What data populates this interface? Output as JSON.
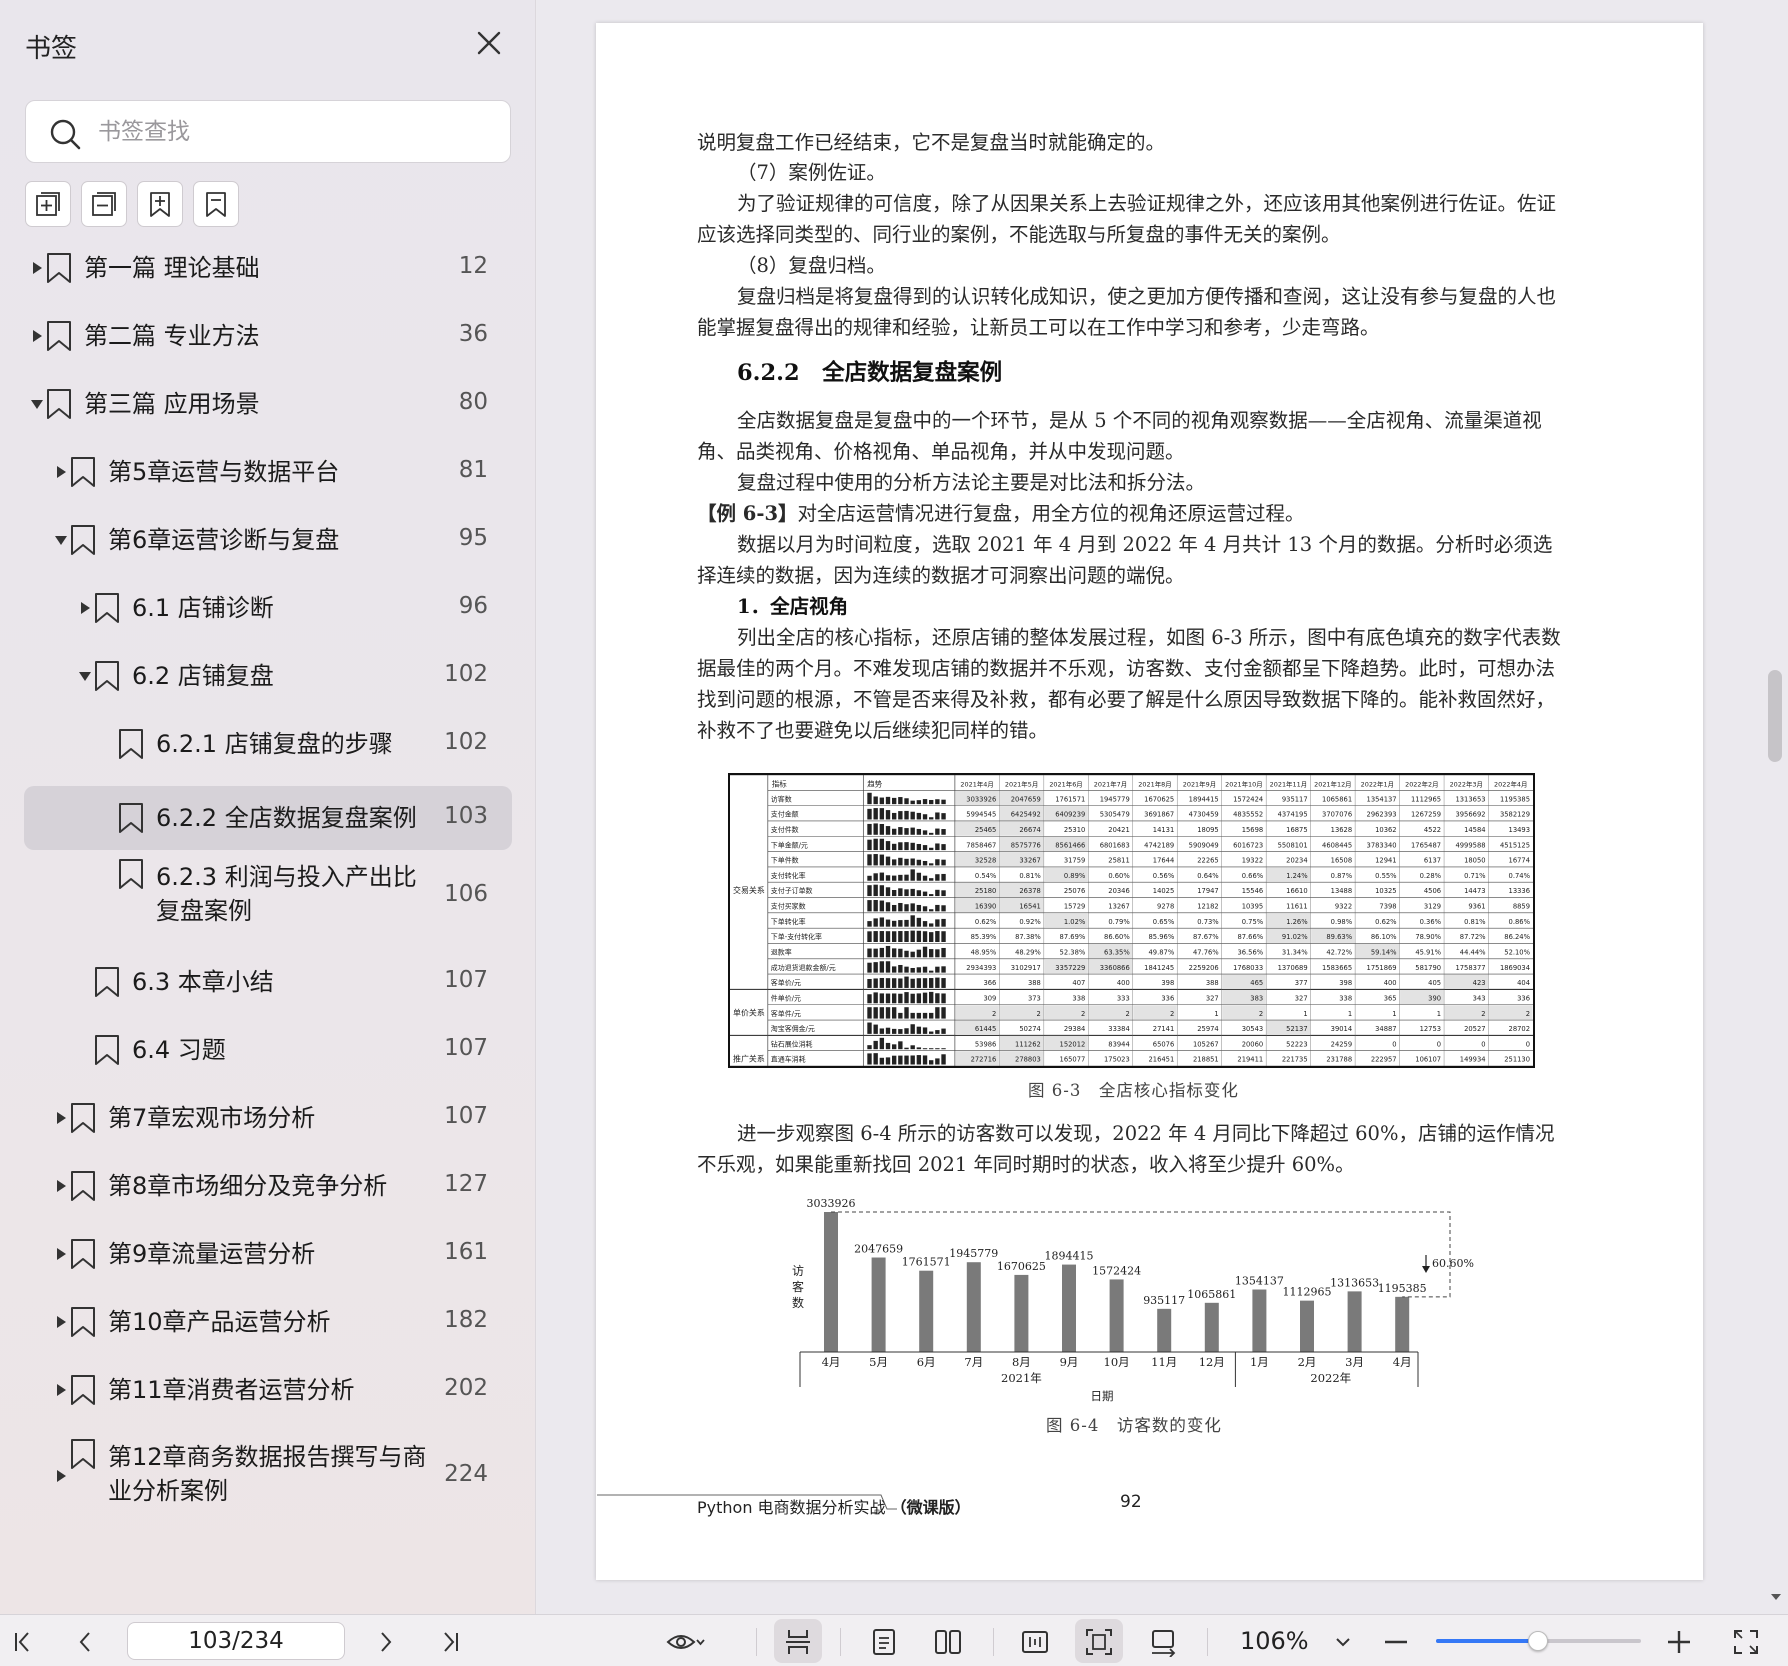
{
  "sidebar": {
    "title": "书签",
    "search_placeholder": "书签查找",
    "tools": [
      "expand-all-icon",
      "collapse-all-icon",
      "add-bookmark-icon",
      "bookmark-icon"
    ],
    "items": [
      {
        "label": "第一篇 理论基础",
        "page": "12"
      },
      {
        "label": "第二篇 专业方法",
        "page": "36"
      },
      {
        "label": "第三篇 应用场景",
        "page": "80"
      },
      {
        "label": "第5章运营与数据平台",
        "page": "81"
      },
      {
        "label": "第6章运营诊断与复盘",
        "page": "95"
      },
      {
        "label": "6.1 店铺诊断",
        "page": "96"
      },
      {
        "label": "6.2 店铺复盘",
        "page": "102"
      },
      {
        "label": "6.2.1 店铺复盘的步骤",
        "page": "102"
      },
      {
        "label": "6.2.2 全店数据复盘案例",
        "page": "103"
      },
      {
        "label_line1": "6.2.3 利润与投入产出比",
        "label_line2": "复盘案例",
        "page": "106"
      },
      {
        "label": "6.3 本章小结",
        "page": "107"
      },
      {
        "label": "6.4 习题",
        "page": "107"
      },
      {
        "label": "第7章宏观市场分析",
        "page": "107"
      },
      {
        "label": "第8章市场细分及竞争分析",
        "page": "127"
      },
      {
        "label": "第9章流量运营分析",
        "page": "161"
      },
      {
        "label": "第10章产品运营分析",
        "page": "182"
      },
      {
        "label": "第11章消费者运营分析",
        "page": "202"
      },
      {
        "label_line1": "第12章商务数据报告撰写与商",
        "label_line2": "业分析案例",
        "page": "224"
      }
    ]
  },
  "document": {
    "p1": "说明复盘工作已经结束，它不是复盘当时就能确定的。",
    "p2": "（7）案例佐证。",
    "p3": "为了验证规律的可信度，除了从因果关系上去验证规律之外，还应该用其他案例进行佐证。佐证应该选择同类型的、同行业的案例，不能选取与所复盘的事件无关的案例。",
    "p4": "（8）复盘归档。",
    "p5": "复盘归档是将复盘得到的认识转化成知识，使之更加方便传播和查阅，这让没有参与复盘的人也能掌握复盘得出的规律和经验，让新员工可以在工作中学习和参考，少走弯路。",
    "heading": "6.2.2　全店数据复盘案例",
    "p6": "全店数据复盘是复盘中的一个环节，是从 5 个不同的视角观察数据——全店视角、流量渠道视角、品类视角、价格视角、单品视角，并从中发现问题。",
    "p7": "复盘过程中使用的分析方法论主要是对比法和拆分法。",
    "p8_tag": "【例 6-3】",
    "p8": "对全店运营情况进行复盘，用全方位的视角还原运营过程。",
    "p9": "数据以月为时间粒度，选取 2021 年 4 月到 2022 年 4 月共计 13 个月的数据。分析时必须选择连续的数据，因为连续的数据才可洞察出问题的端倪。",
    "sub1": "1．全店视角",
    "p10": "列出全店的核心指标，还原店铺的整体发展过程，如图 6-3 所示，图中有底色填充的数字代表数据最佳的两个月。不难发现店铺的数据并不乐观，访客数、支付金额都呈下降趋势。此时，可想办法找到问题的根源，不管是否来得及补救，都有必要了解是什么原因导致数据下降的。能补救固然好，补救不了也要避免以后继续犯同样的错。",
    "fig1_caption": "图 6-3　全店核心指标变化",
    "p11": "进一步观察图 6-4 所示的访客数可以发现，2022 年 4 月同比下降超过 60%，店铺的运作情况不乐观，如果能重新找回 2021 年同时期时的状态，收入将至少提升 60%。",
    "fig2_caption": "图 6-4　访客数的变化",
    "footer_book": "Python 电商数据分析实战",
    "footer_edition": "（微课版）",
    "footer_page": "92"
  },
  "table": {
    "header": [
      "指标",
      "趋势",
      "2021年4月",
      "2021年5月",
      "2021年6月",
      "2021年7月",
      "2021年8月",
      "2021年9月",
      "2021年10月",
      "2021年11月",
      "2021年12月",
      "2022年1月",
      "2022年2月",
      "2022年3月",
      "2022年4月"
    ],
    "groups": [
      {
        "name": "交易关系",
        "span": 13
      },
      {
        "name": "单价关系",
        "span": 3
      },
      {
        "name": "推广关系",
        "span": 3
      }
    ],
    "rows": [
      {
        "name": "访客数",
        "values": [
          "3033926",
          "2047659",
          "1761571",
          "1945779",
          "1670625",
          "1894415",
          "1572424",
          "935117",
          "1065861",
          "1354137",
          "1112965",
          "1313653",
          "1195385"
        ]
      },
      {
        "name": "支付金额",
        "values": [
          "5994545",
          "6425492",
          "6409239",
          "5305479",
          "3691867",
          "4730459",
          "4835552",
          "4374195",
          "3707076",
          "2962393",
          "1267259",
          "3956692",
          "3582129"
        ]
      },
      {
        "name": "支付件数",
        "values": [
          "25465",
          "26674",
          "25310",
          "20421",
          "14131",
          "18095",
          "15698",
          "16875",
          "13628",
          "10362",
          "4522",
          "14584",
          "13493"
        ]
      },
      {
        "name": "下单金额/元",
        "values": [
          "7858467",
          "8575776",
          "8561466",
          "6801683",
          "4742189",
          "5909049",
          "6016723",
          "5508101",
          "4608445",
          "3783340",
          "1765487",
          "4999588",
          "4515125"
        ]
      },
      {
        "name": "下单件数",
        "values": [
          "32528",
          "33267",
          "31759",
          "25811",
          "17644",
          "22265",
          "19322",
          "20234",
          "16508",
          "12941",
          "6137",
          "18050",
          "16774"
        ]
      },
      {
        "name": "支付转化率",
        "values": [
          "0.54%",
          "0.81%",
          "0.89%",
          "0.60%",
          "0.56%",
          "0.64%",
          "0.66%",
          "1.24%",
          "0.87%",
          "0.55%",
          "0.28%",
          "0.71%",
          "0.74%"
        ]
      },
      {
        "name": "支付子订单数",
        "values": [
          "25180",
          "26378",
          "25076",
          "20346",
          "14025",
          "17947",
          "15546",
          "16610",
          "13488",
          "10325",
          "4506",
          "14473",
          "13336"
        ]
      },
      {
        "name": "支付买家数",
        "values": [
          "16390",
          "16541",
          "15729",
          "13267",
          "9278",
          "12182",
          "10395",
          "11611",
          "9322",
          "7398",
          "3129",
          "9361",
          "8859"
        ]
      },
      {
        "name": "下单转化率",
        "values": [
          "0.62%",
          "0.92%",
          "1.02%",
          "0.79%",
          "0.65%",
          "0.73%",
          "0.75%",
          "1.26%",
          "0.98%",
          "0.62%",
          "0.36%",
          "0.81%",
          "0.86%"
        ]
      },
      {
        "name": "下单-支付转化率",
        "values": [
          "85.39%",
          "87.38%",
          "87.69%",
          "86.60%",
          "85.96%",
          "87.67%",
          "87.66%",
          "91.02%",
          "89.63%",
          "86.10%",
          "78.90%",
          "87.72%",
          "86.24%"
        ]
      },
      {
        "name": "退款率",
        "values": [
          "48.95%",
          "48.29%",
          "52.38%",
          "63.35%",
          "49.87%",
          "47.76%",
          "36.56%",
          "31.34%",
          "42.72%",
          "59.14%",
          "45.91%",
          "44.44%",
          "52.10%"
        ]
      },
      {
        "name": "成功退货退款金额/元",
        "values": [
          "2934393",
          "3102917",
          "3357229",
          "3360866",
          "1841245",
          "2259206",
          "1768033",
          "1370689",
          "1583665",
          "1751869",
          "581790",
          "1758377",
          "1869034"
        ]
      },
      {
        "name": "客单价/元",
        "values": [
          "366",
          "388",
          "407",
          "400",
          "398",
          "388",
          "465",
          "377",
          "398",
          "400",
          "405",
          "423",
          "404"
        ]
      },
      {
        "name": "件单价/元",
        "values": [
          "309",
          "373",
          "338",
          "333",
          "336",
          "327",
          "383",
          "327",
          "338",
          "365",
          "390",
          "343",
          "336"
        ]
      },
      {
        "name": "客单件/元",
        "values": [
          "2",
          "2",
          "2",
          "2",
          "2",
          "1",
          "2",
          "1",
          "1",
          "1",
          "1",
          "2",
          "2"
        ]
      },
      {
        "name": "淘宝客佣金/元",
        "values": [
          "61445",
          "50274",
          "29384",
          "33384",
          "27141",
          "25974",
          "30543",
          "52137",
          "39014",
          "34887",
          "12753",
          "20527",
          "28702"
        ]
      },
      {
        "name": "钻石展位消耗",
        "values": [
          "53986",
          "111262",
          "152012",
          "83944",
          "65076",
          "105267",
          "20060",
          "52223",
          "24259",
          "0",
          "0",
          "0",
          "0"
        ]
      },
      {
        "name": "直通车消耗",
        "values": [
          "272716",
          "278803",
          "165077",
          "175023",
          "216451",
          "218851",
          "219411",
          "221735",
          "231788",
          "222957",
          "106107",
          "149934",
          "251130"
        ]
      }
    ]
  },
  "chart_data": {
    "type": "bar",
    "title": "",
    "ylabel": "访客数",
    "xlabel": "日期",
    "categories": [
      "4月",
      "5月",
      "6月",
      "7月",
      "8月",
      "9月",
      "10月",
      "11月",
      "12月",
      "1月",
      "2月",
      "3月",
      "4月"
    ],
    "year_groups": [
      {
        "label": "2021年",
        "from": 0,
        "to": 8
      },
      {
        "label": "2022年",
        "from": 9,
        "to": 12
      }
    ],
    "values": [
      3033926,
      2047659,
      1761571,
      1945779,
      1670625,
      1894415,
      1572424,
      935117,
      1065861,
      1354137,
      1112965,
      1313653,
      1195385
    ],
    "ylim": [
      0,
      3033926
    ],
    "annotation": "60.60%",
    "bar_color": "#7a7a7a"
  },
  "toolbar": {
    "page_indicator": "103/234",
    "zoom": "106%"
  },
  "colors": {
    "accent": "#3578f6",
    "sidebar_bg": "#e9e6ec",
    "active_row": "#d6d2d8"
  }
}
